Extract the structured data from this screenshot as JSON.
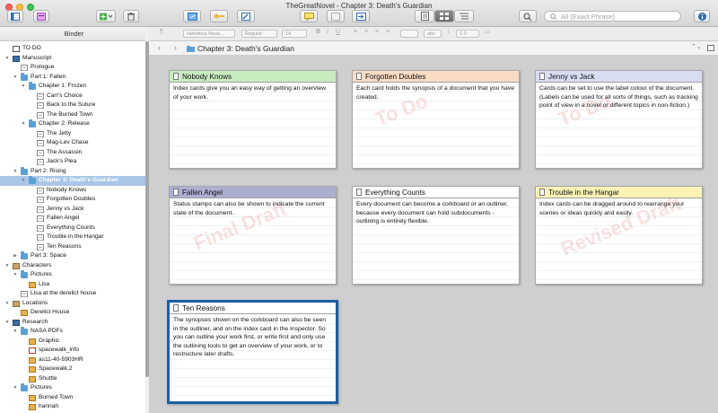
{
  "window": {
    "title": "TheGreatNovel - Chapter 3: Death's Guardian"
  },
  "toolbar": {
    "search_placeholder": "All (Exact Phrase)"
  },
  "format_bar": {
    "font": "Helvetica Neue...",
    "style": "Regular",
    "size": "14",
    "line_spacing": "1.0",
    "abc": "abc"
  },
  "binder": {
    "header": "Binder",
    "items": [
      {
        "label": "TO DO",
        "level": 0,
        "icon": "checkbox-icon",
        "expand": ""
      },
      {
        "label": "Manuscript",
        "level": 0,
        "icon": "manuscript-icon",
        "expand": "open"
      },
      {
        "label": "Prologue",
        "level": 1,
        "icon": "document-icon",
        "expand": ""
      },
      {
        "label": "Part 1: Fallen",
        "level": 1,
        "icon": "folder-icon",
        "expand": "open"
      },
      {
        "label": "Chapter 1: Frozen",
        "level": 2,
        "icon": "folder-icon",
        "expand": "open"
      },
      {
        "label": "Carr's Choice",
        "level": 3,
        "icon": "document-icon",
        "expand": ""
      },
      {
        "label": "Back to the Suture",
        "level": 3,
        "icon": "document-icon",
        "expand": ""
      },
      {
        "label": "The Burned Town",
        "level": 3,
        "icon": "document-icon",
        "expand": ""
      },
      {
        "label": "Chapter 2: Release",
        "level": 2,
        "icon": "folder-icon",
        "expand": "open"
      },
      {
        "label": "The Jetty",
        "level": 3,
        "icon": "document-icon",
        "expand": ""
      },
      {
        "label": "Mag-Lev Chase",
        "level": 3,
        "icon": "document-icon",
        "expand": ""
      },
      {
        "label": "The Assassin",
        "level": 3,
        "icon": "document-icon",
        "expand": ""
      },
      {
        "label": "Jack's Plea",
        "level": 3,
        "icon": "document-icon",
        "expand": ""
      },
      {
        "label": "Part 2: Rising",
        "level": 1,
        "icon": "folder-icon",
        "expand": "open"
      },
      {
        "label": "Chapter 3: Death's Guardian",
        "level": 2,
        "icon": "folder-icon",
        "expand": "open",
        "selected": true
      },
      {
        "label": "Nobody Knows",
        "level": 3,
        "icon": "document-icon",
        "expand": ""
      },
      {
        "label": "Forgotten Doubles",
        "level": 3,
        "icon": "document-icon",
        "expand": ""
      },
      {
        "label": "Jenny vs Jack",
        "level": 3,
        "icon": "document-icon",
        "expand": ""
      },
      {
        "label": "Fallen Angel",
        "level": 3,
        "icon": "document-icon",
        "expand": ""
      },
      {
        "label": "Everything Counts",
        "level": 3,
        "icon": "document-icon",
        "expand": ""
      },
      {
        "label": "Trouble in the Hangar",
        "level": 3,
        "icon": "document-icon",
        "expand": ""
      },
      {
        "label": "Ten Reasons",
        "level": 3,
        "icon": "document-icon",
        "expand": ""
      },
      {
        "label": "Part 3: Space",
        "level": 1,
        "icon": "folder-icon",
        "expand": "closed"
      },
      {
        "label": "Characters",
        "level": 0,
        "icon": "box-icon",
        "expand": "open"
      },
      {
        "label": "Pictures",
        "level": 1,
        "icon": "folder-icon",
        "expand": "open"
      },
      {
        "label": "Lisa",
        "level": 2,
        "icon": "image-icon",
        "expand": ""
      },
      {
        "label": "Lisa at the derelict house",
        "level": 1,
        "icon": "document-icon",
        "expand": ""
      },
      {
        "label": "Locations",
        "level": 0,
        "icon": "box-icon",
        "expand": "open"
      },
      {
        "label": "Derelict House",
        "level": 1,
        "icon": "image-icon",
        "expand": ""
      },
      {
        "label": "Research",
        "level": 0,
        "icon": "book-icon",
        "expand": "open"
      },
      {
        "label": "NASA PDFs",
        "level": 1,
        "icon": "folder-icon",
        "expand": "open"
      },
      {
        "label": "Graphic",
        "level": 2,
        "icon": "image-icon",
        "expand": ""
      },
      {
        "label": "spacewalk_info",
        "level": 2,
        "icon": "pdf-icon",
        "expand": ""
      },
      {
        "label": "as11-40-5903HR",
        "level": 2,
        "icon": "image-icon",
        "expand": ""
      },
      {
        "label": "Spacewalk.2",
        "level": 2,
        "icon": "image-icon",
        "expand": ""
      },
      {
        "label": "Shuttle",
        "level": 2,
        "icon": "image-icon",
        "expand": ""
      },
      {
        "label": "Pictures",
        "level": 1,
        "icon": "folder-icon",
        "expand": "open"
      },
      {
        "label": "Burned Town",
        "level": 2,
        "icon": "image-icon",
        "expand": ""
      },
      {
        "label": "hannah",
        "level": 2,
        "icon": "image-icon",
        "expand": ""
      }
    ]
  },
  "navigation": {
    "current": "Chapter 3: Death's Guardian"
  },
  "cards": [
    {
      "title": "Nobody Knows",
      "label_color": "#c8ecc0",
      "stamp": "",
      "body": "Index cards give you an easy way of getting an overview of your work."
    },
    {
      "title": "Forgotten Doubles",
      "label_color": "#f8dcc4",
      "stamp": "To Do",
      "body": "Each card holds the synopsis of a document that you have created."
    },
    {
      "title": "Jenny vs Jack",
      "label_color": "#d8ddf2",
      "stamp": "To Do",
      "body": "Cards can be set to use the label colour of the document. (Labels can be used for all sorts of things, such as tracking point of view in a novel or different topics in non-fiction.)"
    },
    {
      "title": "Fallen Angel",
      "label_color": "#aeaed0",
      "stamp": "Final Draft",
      "body": "Status stamps can also be shown to indicate the current state of the document."
    },
    {
      "title": "Everything Counts",
      "label_color": "#ffffff",
      "stamp": "",
      "body": "Every document can become a corkboard or an outliner, because every document can hold subdocuments - outlining is entirely flexible."
    },
    {
      "title": "Trouble in the Hangar",
      "label_color": "#fbf3b6",
      "stamp": "Revised Draft",
      "body": "Index cards can be dragged around to rearrange your scenes or ideas quickly and easily."
    },
    {
      "title": "Ten Reasons",
      "label_color": "#ffffff",
      "stamp": "",
      "selected": true,
      "body": "The synopses shown on the corkboard can also be seen in the outliner, and on the index card in the Inspector. So you can outline your work first, or write first and only use the outlining tools to get an overview of your work, or to restructure later drafts."
    }
  ],
  "colors": {
    "accent": "#1a5fa8",
    "selection": "#a8c6e7",
    "corkboard": "#cfcfcf"
  }
}
